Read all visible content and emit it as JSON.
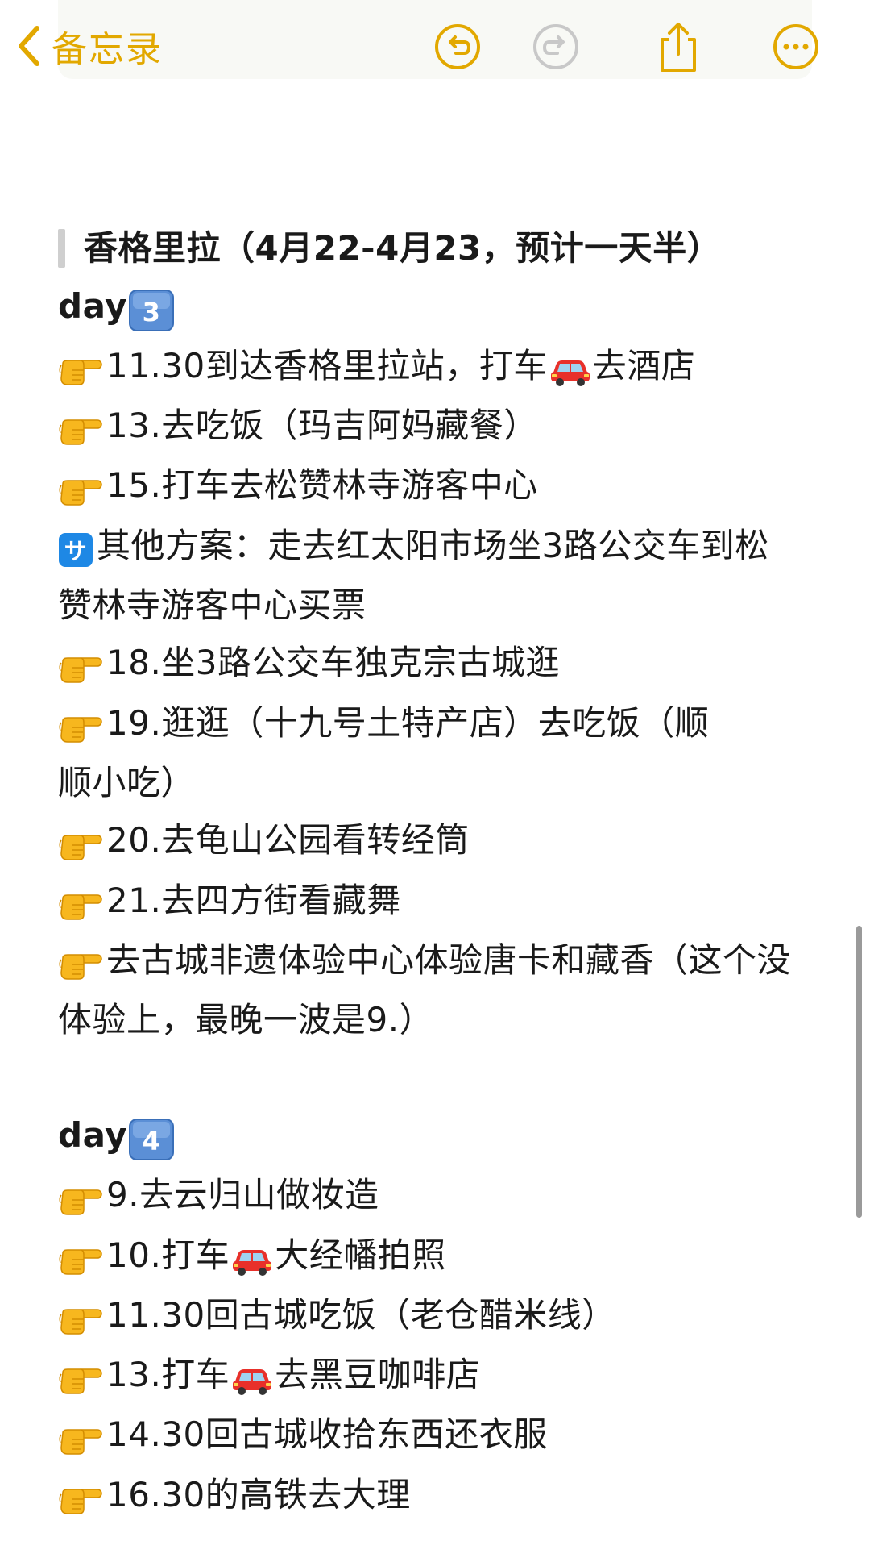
{
  "nav": {
    "back_label": "备忘录"
  },
  "note": {
    "heading": "香格里拉（4月22-4月23，预计一天半）",
    "day3": {
      "label": "day",
      "badge": "3"
    },
    "day3_items": [
      "11.30到达香格里拉站，打车",
      "去酒店",
      "13.去吃饭（玛吉阿妈藏餐）",
      "15.打车去松赞林寺游客中心",
      "其他方案：走去红太阳市场坐3路公交车到松赞林寺游客中心买票",
      "18.坐3路公交车独克宗古城逛",
      "19.逛逛（十九号土特产店）去吃饭（顺顺小吃）",
      "20.去龟山公园看转经筒",
      "21.去四方街看藏舞",
      "去古城非遗体验中心体验唐卡和藏香（这个没体验上，最晚一波是9.）"
    ],
    "day4": {
      "label": "day",
      "badge": "4"
    },
    "day4_items": [
      "9.去云归山做妆造",
      "10.打车",
      "大经幡拍照",
      "11.30回古城吃饭（老仓醋米线）",
      "13.打车",
      "去黑豆咖啡店",
      "14.30回古城收拾东西还衣服",
      "16.30的高铁去大理"
    ]
  },
  "icons": {
    "accent": "#e2a800",
    "disabled": "#c8c8c8",
    "back": "chevron-left-icon",
    "undo": "undo-icon",
    "redo": "redo-icon",
    "share": "share-icon",
    "more": "more-icon",
    "pointer": "backhand-index-pointing-right-emoji",
    "car": "red-car-emoji",
    "sa": "service-charge-sa-emoji"
  }
}
